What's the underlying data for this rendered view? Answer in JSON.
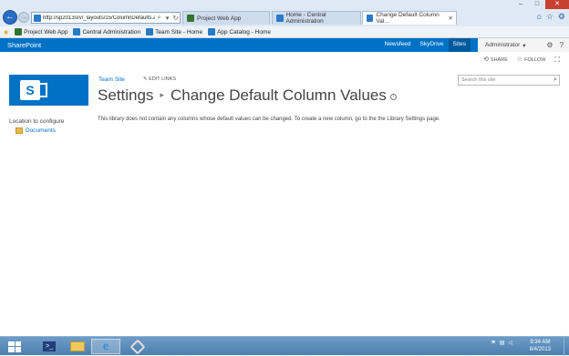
{
  "browser": {
    "address": "http://sp2013srv/_layouts/15/ColumnDefaults.as",
    "address_icons": [
      "search-icon",
      "dropdown-icon",
      "refresh-icon"
    ],
    "tabs": [
      {
        "label": "Project Web App",
        "icon": "pwa-icon"
      },
      {
        "label": "Home - Central Administration",
        "icon": "sharepoint-icon"
      },
      {
        "label": "Change Default Column Val...",
        "icon": "sharepoint-icon",
        "active": true
      }
    ],
    "favorites": [
      {
        "label": "Project Web App",
        "icon": "pwa-icon"
      },
      {
        "label": "Central Administration",
        "icon": "sharepoint-icon"
      },
      {
        "label": "Team Site - Home",
        "icon": "sharepoint-icon"
      },
      {
        "label": "App Catalog - Home",
        "icon": "sharepoint-icon"
      }
    ]
  },
  "suite": {
    "brand": "SharePoint",
    "links": [
      "Newsfeed",
      "SkyDrive",
      "Sites"
    ],
    "selected_link": "Sites",
    "user": "Administrator"
  },
  "actions": {
    "share": "SHARE",
    "follow": "FOLLOW"
  },
  "page": {
    "breadcrumb": "Team Site",
    "edit_links": "EDIT LINKS",
    "title_part1": "Settings",
    "title_part2": "Change Default Column Values",
    "search_placeholder": "Search this site",
    "left_header": "Location to configure",
    "left_item": "Documents",
    "message": "This library does not contain any columns whose default values can be changed. To create a new column, go to the the Library Settings page."
  },
  "taskbar": {
    "time": "9:34 AM",
    "date": "8/4/2013",
    "items": [
      "start-button",
      "powershell-icon",
      "file-explorer-icon",
      "internet-explorer-icon",
      "tool-icon"
    ]
  },
  "colors": {
    "suite": "#0072c6",
    "link": "#0072c6"
  }
}
